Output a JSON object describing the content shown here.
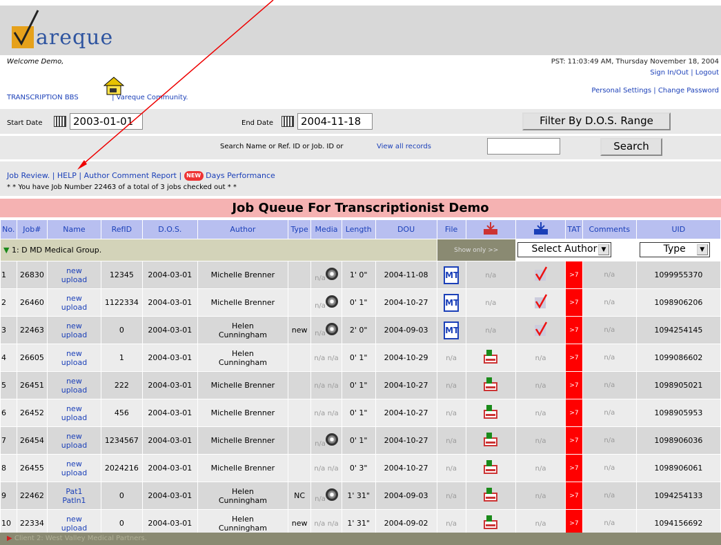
{
  "brand": {
    "logo_text": "areque"
  },
  "header": {
    "welcome": "Welcome Demo,",
    "pst": "PST: 11:03:49 AM, Thursday November 18, 2004",
    "sign": "Sign In/Out | Logout",
    "bbs": "TRANSCRIPTION BBS",
    "community": "| Vareque Community.",
    "settings": "Personal Settings | Change Password"
  },
  "filter": {
    "start_label": "Start Date",
    "start_value": "2003-01-01",
    "end_label": "End Date",
    "end_value": "2004-11-18",
    "filter_btn": "Filter By D.O.S. Range",
    "search_prompt": "Search Name or Ref. ID or Job. ID or",
    "view_all": "View all records",
    "search_value": "",
    "search_btn": "Search"
  },
  "links": {
    "job_review": "Job Review.",
    "help": "| HELP |",
    "author_report": "Author Comment Report |",
    "new_badge": "NEW",
    "days_perf": "Days Performance",
    "checked_out": "* * You have Job Number 22463 of a total of 3 jobs checked out * *"
  },
  "queue_title": "Job Queue For Transcriptionist Demo",
  "columns": [
    "No.",
    "Job#",
    "Name",
    "RefID",
    "D.O.S.",
    "Author",
    "Type",
    "Media",
    "Length",
    "DOU",
    "File",
    "",
    "",
    "TAT",
    "Comments",
    "UID"
  ],
  "group1": {
    "label": "1: D MD Medical Group.",
    "show_only": "Show only >>",
    "select_author": "Select Author",
    "type": "Type"
  },
  "rows": [
    {
      "no": "1",
      "job": "26830",
      "name1": "new",
      "name2": "upload",
      "ref": "12345",
      "dos": "2004-03-01",
      "author1": "Michelle Brenner",
      "author2": "",
      "type": "",
      "media": "n/a",
      "disc": true,
      "len": "1' 0\"",
      "dou": "2004-11-08",
      "file": "MT",
      "recv": "n/a",
      "chk": true,
      "tat": ">7",
      "comments": "n/a",
      "uid": "1099955370"
    },
    {
      "no": "2",
      "job": "26460",
      "name1": "new",
      "name2": "upload",
      "ref": "1122334",
      "dos": "2004-03-01",
      "author1": "Michelle Brenner",
      "author2": "",
      "type": "",
      "media": "n/a",
      "disc": true,
      "len": "0' 1\"",
      "dou": "2004-10-27",
      "file": "MT",
      "recv": "n/a",
      "chk": true,
      "tat": ">7",
      "comments": "n/a",
      "uid": "1098906206"
    },
    {
      "no": "3",
      "job": "22463",
      "name1": "new",
      "name2": "upload",
      "ref": "0",
      "dos": "2004-03-01",
      "author1": "Helen",
      "author2": "Cunningham",
      "type": "new",
      "media": "n/a",
      "disc": true,
      "len": "2' 0\"",
      "dou": "2004-09-03",
      "file": "MT",
      "recv": "n/a",
      "chk": true,
      "tat": ">7",
      "comments": "n/a",
      "uid": "1094254145"
    },
    {
      "no": "4",
      "job": "26605",
      "name1": "new",
      "name2": "upload",
      "ref": "1",
      "dos": "2004-03-01",
      "author1": "Helen",
      "author2": "Cunningham",
      "type": "",
      "media": "n/a",
      "disc": false,
      "media2": "n/a",
      "len": "0' 1\"",
      "dou": "2004-10-29",
      "file": "n/a",
      "recv": "icon",
      "chk": false,
      "chkna": "n/a",
      "tat": ">7",
      "comments": "n/a",
      "uid": "1099086602"
    },
    {
      "no": "5",
      "job": "26451",
      "name1": "new",
      "name2": "upload",
      "ref": "222",
      "dos": "2004-03-01",
      "author1": "Michelle Brenner",
      "author2": "",
      "type": "",
      "media": "n/a",
      "disc": false,
      "media2": "n/a",
      "len": "0' 1\"",
      "dou": "2004-10-27",
      "file": "n/a",
      "recv": "icon",
      "chk": false,
      "chkna": "n/a",
      "tat": ">7",
      "comments": "n/a",
      "uid": "1098905021"
    },
    {
      "no": "6",
      "job": "26452",
      "name1": "new",
      "name2": "upload",
      "ref": "456",
      "dos": "2004-03-01",
      "author1": "Michelle Brenner",
      "author2": "",
      "type": "",
      "media": "n/a",
      "disc": false,
      "media2": "n/a",
      "len": "0' 1\"",
      "dou": "2004-10-27",
      "file": "n/a",
      "recv": "icon",
      "chk": false,
      "chkna": "n/a",
      "tat": ">7",
      "comments": "n/a",
      "uid": "1098905953"
    },
    {
      "no": "7",
      "job": "26454",
      "name1": "new",
      "name2": "upload",
      "ref": "1234567",
      "dos": "2004-03-01",
      "author1": "Michelle Brenner",
      "author2": "",
      "type": "",
      "media": "n/a",
      "disc": true,
      "len": "0' 1\"",
      "dou": "2004-10-27",
      "file": "n/a",
      "recv": "icon",
      "chk": false,
      "chkna": "n/a",
      "tat": ">7",
      "comments": "n/a",
      "uid": "1098906036"
    },
    {
      "no": "8",
      "job": "26455",
      "name1": "new",
      "name2": "upload",
      "ref": "2024216",
      "dos": "2004-03-01",
      "author1": "Michelle Brenner",
      "author2": "",
      "type": "",
      "media": "n/a",
      "disc": false,
      "media2": "n/a",
      "len": "0' 3\"",
      "dou": "2004-10-27",
      "file": "n/a",
      "recv": "icon",
      "chk": false,
      "chkna": "n/a",
      "tat": ">7",
      "comments": "n/a",
      "uid": "1098906061"
    },
    {
      "no": "9",
      "job": "22462",
      "name1": "Pat1",
      "name2": "Patln1",
      "ref": "0",
      "dos": "2004-03-01",
      "author1": "Helen",
      "author2": "Cunningham",
      "type": "NC",
      "media": "n/a",
      "disc": true,
      "len": "1' 31\"",
      "dou": "2004-09-03",
      "file": "n/a",
      "recv": "icon",
      "chk": false,
      "chkna": "n/a",
      "tat": ">7",
      "comments": "n/a",
      "uid": "1094254133"
    },
    {
      "no": "10",
      "job": "22334",
      "name1": "new",
      "name2": "upload",
      "ref": "0",
      "dos": "2004-03-01",
      "author1": "Helen",
      "author2": "Cunningham",
      "type": "new",
      "media": "n/a",
      "disc": false,
      "media2": "n/a",
      "len": "1' 31\"",
      "dou": "2004-09-02",
      "file": "n/a",
      "recv": "icon",
      "chk": false,
      "chkna": "n/a",
      "tat": ">7",
      "comments": "n/a",
      "uid": "1094156692"
    }
  ],
  "group2": {
    "label": "Client 2: West Valley Medical Partners."
  }
}
